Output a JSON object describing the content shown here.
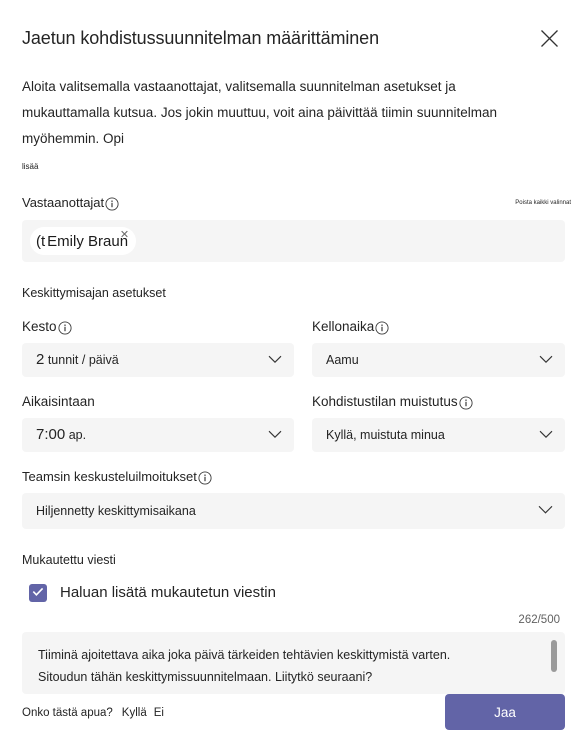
{
  "dialog": {
    "title": "Jaetun kohdistussuunnitelman määrittäminen",
    "close_label": "close-icon",
    "intro": "Aloita valitsemalla vastaanottajat, valitsemalla suunnitelman asetukset ja mukauttamalla kutsua. Jos jokin muuttuu, voit aina päivittää tiimin suunnitelman myöhemmin. Opi",
    "intro_link": "lisää"
  },
  "recipients": {
    "label": "Vastaanottajat",
    "info_icon": "info-icon",
    "clear_all": "Poista kaikki valinnat",
    "chip": {
      "avatar": "(t",
      "name": "Emily Braun",
      "remove": "✕"
    }
  },
  "focus_settings": {
    "section_title": "Keskittymisajan asetukset",
    "duration": {
      "label": "Kesto",
      "info_icon": "info-icon",
      "value_lead": "2",
      "value_rest": "tunnit / päivä"
    },
    "time_of_day": {
      "label": "Kellonaika",
      "info_icon": "info-icon",
      "value": "Aamu"
    },
    "earliest": {
      "label": "Aikaisintaan",
      "value_lead": "7:00",
      "value_rest": "ap."
    },
    "focus_reminder": {
      "label": "Kohdistustilan muistutus",
      "info_icon": "info-icon",
      "value": "Kyllä, muistuta minua"
    },
    "teams_notifications": {
      "label": "Teamsin keskusteluilmoitukset",
      "info_icon": "info-icon",
      "value": "Hiljennetty keskittymisaikana"
    }
  },
  "custom_message": {
    "section_title": "Mukautettu viesti",
    "checkbox_label": "Haluan lisätä mukautetun viestin",
    "checkbox_checked": true,
    "counter": "262/500",
    "text": "Tiiminä ajoitettava aika joka päivä tärkeiden tehtävien keskittymistä varten.\nSitoudun tähän keskittymissuunnitelmaan. Liitytkö seuraani?"
  },
  "footer": {
    "helpful_question": "Onko tästä apua?",
    "helpful_yes": "Kyllä",
    "helpful_no": "Ei",
    "share_label": "Jaa"
  },
  "colors": {
    "accent": "#6264a7",
    "field_bg": "#f5f5f5",
    "text": "#242424"
  }
}
